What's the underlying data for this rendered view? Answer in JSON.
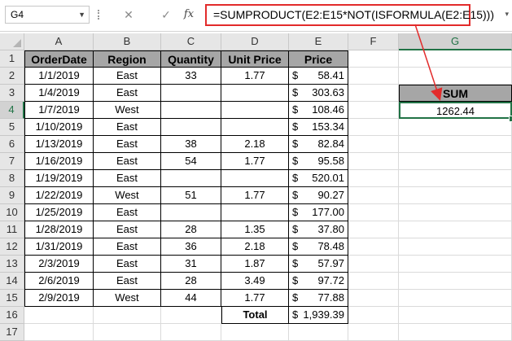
{
  "formula_bar": {
    "name_box": "G4",
    "cancel_glyph": "✕",
    "enter_glyph": "✓",
    "fx_label": "fx",
    "formula": "=SUMPRODUCT(E2:E15*NOT(ISFORMULA(E2:E15)))"
  },
  "columns": [
    "A",
    "B",
    "C",
    "D",
    "E",
    "F",
    "G"
  ],
  "rows": [
    "1",
    "2",
    "3",
    "4",
    "5",
    "6",
    "7",
    "8",
    "9",
    "10",
    "11",
    "12",
    "13",
    "14",
    "15",
    "16",
    "17"
  ],
  "table": {
    "headers": [
      "OrderDate",
      "Region",
      "Quantity",
      "Unit Price",
      "Price"
    ],
    "rows": [
      {
        "date": "1/1/2019",
        "region": "East",
        "qty": "33",
        "unit": "1.77",
        "cur": "$",
        "price": "58.41"
      },
      {
        "date": "1/4/2019",
        "region": "East",
        "qty": "",
        "unit": "",
        "cur": "$",
        "price": "303.63"
      },
      {
        "date": "1/7/2019",
        "region": "West",
        "qty": "",
        "unit": "",
        "cur": "$",
        "price": "108.46"
      },
      {
        "date": "1/10/2019",
        "region": "East",
        "qty": "",
        "unit": "",
        "cur": "$",
        "price": "153.34"
      },
      {
        "date": "1/13/2019",
        "region": "East",
        "qty": "38",
        "unit": "2.18",
        "cur": "$",
        "price": "82.84"
      },
      {
        "date": "1/16/2019",
        "region": "East",
        "qty": "54",
        "unit": "1.77",
        "cur": "$",
        "price": "95.58"
      },
      {
        "date": "1/19/2019",
        "region": "East",
        "qty": "",
        "unit": "",
        "cur": "$",
        "price": "520.01"
      },
      {
        "date": "1/22/2019",
        "region": "West",
        "qty": "51",
        "unit": "1.77",
        "cur": "$",
        "price": "90.27"
      },
      {
        "date": "1/25/2019",
        "region": "East",
        "qty": "",
        "unit": "",
        "cur": "$",
        "price": "177.00"
      },
      {
        "date": "1/28/2019",
        "region": "East",
        "qty": "28",
        "unit": "1.35",
        "cur": "$",
        "price": "37.80"
      },
      {
        "date": "1/31/2019",
        "region": "East",
        "qty": "36",
        "unit": "2.18",
        "cur": "$",
        "price": "78.48"
      },
      {
        "date": "2/3/2019",
        "region": "East",
        "qty": "31",
        "unit": "1.87",
        "cur": "$",
        "price": "57.97"
      },
      {
        "date": "2/6/2019",
        "region": "East",
        "qty": "28",
        "unit": "3.49",
        "cur": "$",
        "price": "97.72"
      },
      {
        "date": "2/9/2019",
        "region": "West",
        "qty": "44",
        "unit": "1.77",
        "cur": "$",
        "price": "77.88"
      }
    ],
    "total_label": "Total",
    "total_cur": "$",
    "total_value": "1,939.39"
  },
  "sum_box": {
    "header": "SUM",
    "value": "1262.44"
  },
  "colors": {
    "accent": "#217346",
    "annotation": "#e22b2b",
    "header_fill": "#a6a6a6"
  }
}
